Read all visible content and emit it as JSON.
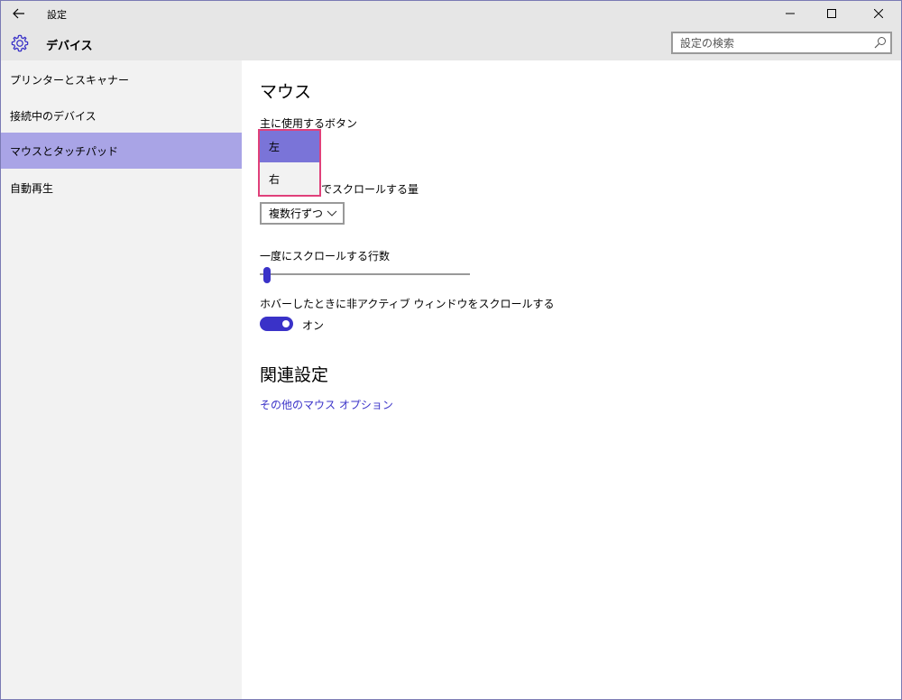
{
  "window": {
    "title": "設定"
  },
  "header": {
    "title": "デバイス",
    "search_placeholder": "設定の検索"
  },
  "sidebar": {
    "items": [
      {
        "label": "プリンターとスキャナー"
      },
      {
        "label": "接続中のデバイス"
      },
      {
        "label": "マウスとタッチパッド"
      },
      {
        "label": "自動再生"
      }
    ],
    "selected_index": 2
  },
  "main": {
    "section_title": "マウス",
    "primary_button": {
      "label": "主に使用するボタン",
      "options": [
        "左",
        "右"
      ],
      "selected": "左"
    },
    "scroll_amount": {
      "label_visible": "でスクロールする量",
      "value": "複数行ずつ"
    },
    "lines_to_scroll": {
      "label": "一度にスクロールする行数"
    },
    "inactive_scroll": {
      "label": "ホバーしたときに非アクティブ ウィンドウをスクロールする",
      "state": "オン"
    },
    "related": {
      "title": "関連設定",
      "link": "その他のマウス オプション"
    }
  },
  "colors": {
    "accent": "#3a32c8",
    "selected_nav": "#a9a4e6",
    "selected_option": "#7a74d8",
    "popup_border": "#e0407a"
  }
}
